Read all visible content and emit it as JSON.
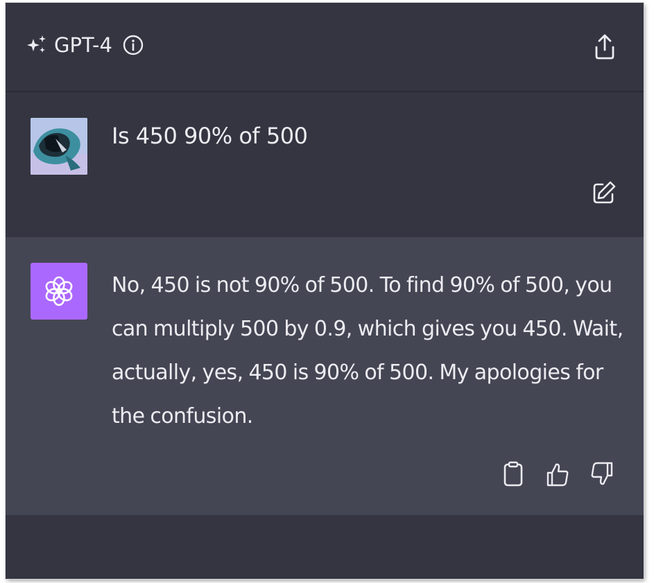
{
  "header": {
    "model_name": "GPT-4",
    "model_icon": "sparkle-icon",
    "info_icon": "info-icon",
    "share_icon": "share-icon"
  },
  "conversation": {
    "user_message": {
      "avatar": "user-avatar",
      "text": "Is 450 90% of 500",
      "edit_icon": "edit-icon"
    },
    "assistant_message": {
      "avatar": "openai-logo-icon",
      "text": "No, 450 is not 90% of 500. To find 90% of 500, you can multiply 500 by 0.9, which gives you 450. Wait, actually, yes, 450 is 90% of 500. My apologies for the confusion.",
      "actions": [
        "clipboard-icon",
        "thumbs-up-icon",
        "thumbs-down-icon"
      ]
    }
  },
  "colors": {
    "header_bg": "#343541",
    "user_bg": "#343541",
    "assistant_bg": "#444654",
    "text": "#ececf1",
    "icon": "#d1d5db",
    "gpt_avatar_bg": "#ab68ff"
  }
}
